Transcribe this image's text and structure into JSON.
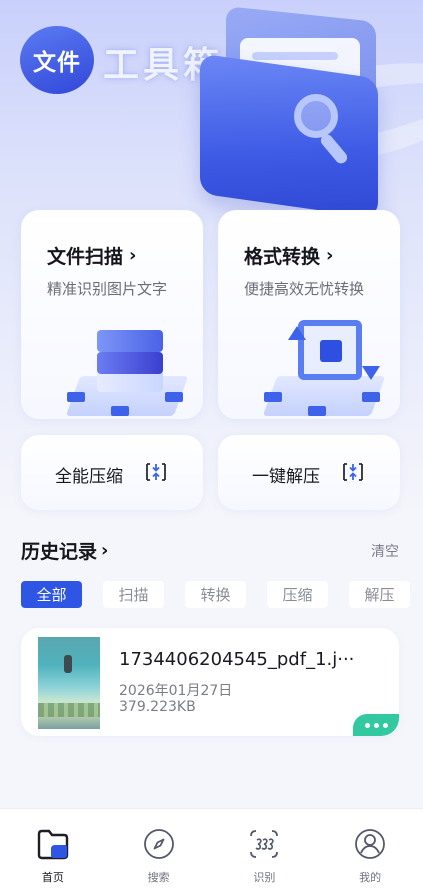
{
  "header": {
    "logo_text": "文件",
    "logo_sub": "工具箱"
  },
  "features": {
    "scan": {
      "title": "文件扫描",
      "subtitle": "精准识别图片文字"
    },
    "convert": {
      "title": "格式转换",
      "subtitle": "便捷高效无忧转换"
    },
    "compress": {
      "label": "全能压缩"
    },
    "extract": {
      "label": "一键解压"
    }
  },
  "history": {
    "title": "历史记录",
    "clear_label": "清空",
    "filters": [
      "全部",
      "扫描",
      "转换",
      "压缩",
      "解压"
    ],
    "active_filter": "全部",
    "records": [
      {
        "name": "1734406204545_pdf_1.j···",
        "date": "2026年01月27日",
        "size": "379.223KB"
      }
    ]
  },
  "tabbar": {
    "tabs": [
      {
        "label": "首页",
        "icon": "folder-home-icon",
        "active": true
      },
      {
        "label": "搜索",
        "icon": "compass-icon",
        "active": false
      },
      {
        "label": "识别",
        "icon": "scan-recognize-icon",
        "active": false
      },
      {
        "label": "我的",
        "icon": "user-profile-icon",
        "active": false
      }
    ]
  },
  "colors": {
    "accent": "#2f55e4",
    "more_button": "#32c9a0"
  }
}
